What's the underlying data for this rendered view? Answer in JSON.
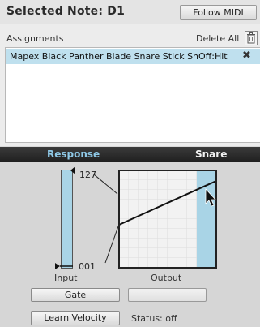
{
  "header": {
    "title": "Selected Note: D1",
    "follow_label": "Follow MIDI"
  },
  "assignments": {
    "label": "Assignments",
    "delete_all_label": "Delete All",
    "items": [
      {
        "text": "Mapex Black Panther Blade Snare Stick SnOff:Hit",
        "remove": "✖"
      }
    ]
  },
  "tabs": {
    "left": "Response",
    "right": "Snare"
  },
  "response": {
    "input_max": "127",
    "input_min": "001",
    "input_label": "Input",
    "output_label": "Output"
  },
  "controls": {
    "gate_label": "Gate",
    "learn_label": "Learn Velocity",
    "status_text": "Status: off"
  },
  "colors": {
    "accent": "#a9d4e6",
    "selection": "#bfe0ee",
    "tab_active": "#8ec8e6"
  }
}
